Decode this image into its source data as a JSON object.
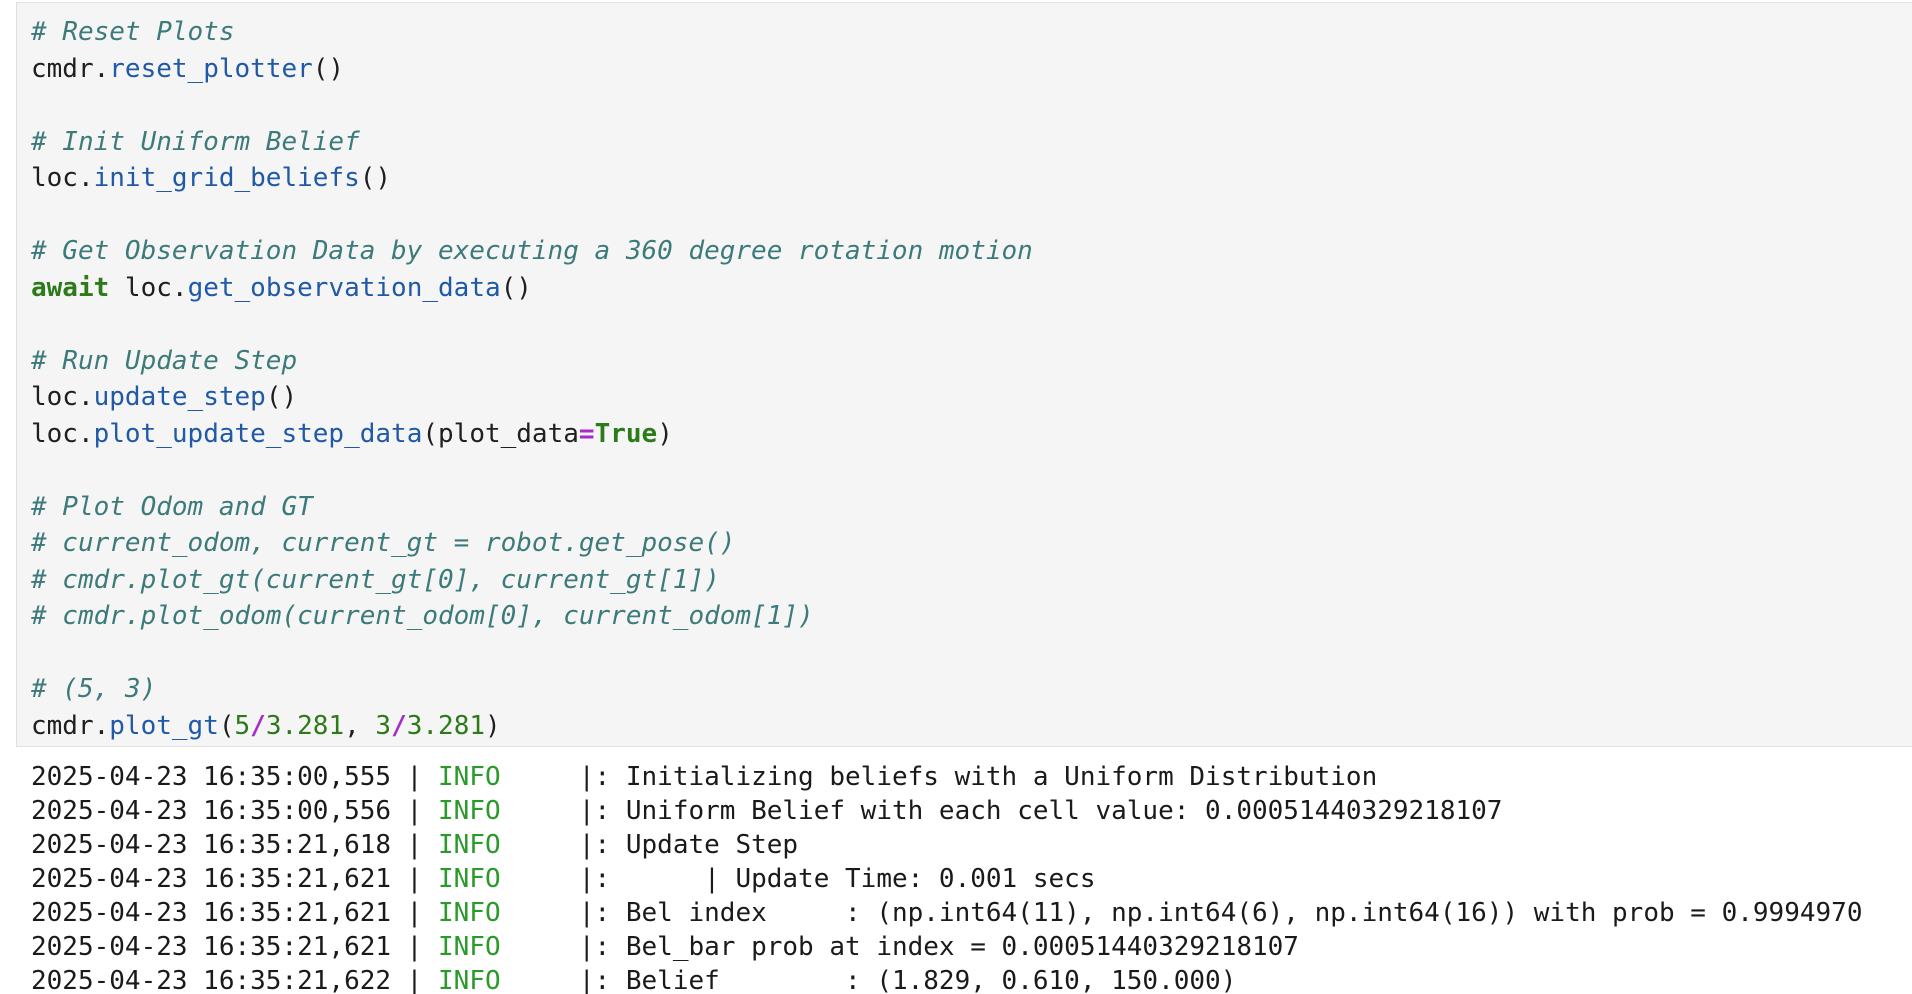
{
  "code_cell": {
    "lines": [
      [
        {
          "t": "# Reset Plots",
          "k": "c"
        }
      ],
      [
        {
          "t": "cmdr.",
          "k": ""
        },
        {
          "t": "reset_plotter",
          "k": "fn"
        },
        {
          "t": "()",
          "k": ""
        }
      ],
      [],
      [
        {
          "t": "# Init Uniform Belief",
          "k": "c"
        }
      ],
      [
        {
          "t": "loc.",
          "k": ""
        },
        {
          "t": "init_grid_beliefs",
          "k": "fn"
        },
        {
          "t": "()",
          "k": ""
        }
      ],
      [],
      [
        {
          "t": "# Get Observation Data by executing a 360 degree rotation motion",
          "k": "c"
        }
      ],
      [
        {
          "t": "await",
          "k": "kw"
        },
        {
          "t": " loc.",
          "k": ""
        },
        {
          "t": "get_observation_data",
          "k": "fn"
        },
        {
          "t": "()",
          "k": ""
        }
      ],
      [],
      [
        {
          "t": "# Run Update Step",
          "k": "c"
        }
      ],
      [
        {
          "t": "loc.",
          "k": ""
        },
        {
          "t": "update_step",
          "k": "fn"
        },
        {
          "t": "()",
          "k": ""
        }
      ],
      [
        {
          "t": "loc.",
          "k": ""
        },
        {
          "t": "plot_update_step_data",
          "k": "fn"
        },
        {
          "t": "(plot_data",
          "k": ""
        },
        {
          "t": "=",
          "k": "op"
        },
        {
          "t": "True",
          "k": "kw"
        },
        {
          "t": ")",
          "k": ""
        }
      ],
      [],
      [
        {
          "t": "# Plot Odom and GT",
          "k": "c"
        }
      ],
      [
        {
          "t": "# current_odom, current_gt = robot.get_pose()",
          "k": "c"
        }
      ],
      [
        {
          "t": "# cmdr.plot_gt(current_gt[0], current_gt[1])",
          "k": "c"
        }
      ],
      [
        {
          "t": "# cmdr.plot_odom(current_odom[0], current_odom[1])",
          "k": "c"
        }
      ],
      [],
      [
        {
          "t": "# (5, 3)",
          "k": "c"
        }
      ],
      [
        {
          "t": "cmdr.",
          "k": ""
        },
        {
          "t": "plot_gt",
          "k": "fn"
        },
        {
          "t": "(",
          "k": ""
        },
        {
          "t": "5",
          "k": "nm"
        },
        {
          "t": "/",
          "k": "op"
        },
        {
          "t": "3.281",
          "k": "nm"
        },
        {
          "t": ", ",
          "k": ""
        },
        {
          "t": "3",
          "k": "nm"
        },
        {
          "t": "/",
          "k": "op"
        },
        {
          "t": "3.281",
          "k": "nm"
        },
        {
          "t": ")",
          "k": ""
        }
      ]
    ]
  },
  "output": {
    "logs": [
      {
        "ts": "2025-04-23 16:35:00,555",
        "level": "INFO",
        "msg": "|: Initializing beliefs with a Uniform Distribution"
      },
      {
        "ts": "2025-04-23 16:35:00,556",
        "level": "INFO",
        "msg": "|: Uniform Belief with each cell value: 0.00051440329218107"
      },
      {
        "ts": "2025-04-23 16:35:21,618",
        "level": "INFO",
        "msg": "|: Update Step"
      },
      {
        "ts": "2025-04-23 16:35:21,621",
        "level": "INFO",
        "msg": "|:      | Update Time: 0.001 secs"
      },
      {
        "ts": "2025-04-23 16:35:21,621",
        "level": "INFO",
        "msg": "|: Bel index     : (np.int64(11), np.int64(6), np.int64(16)) with prob = 0.9994970"
      },
      {
        "ts": "2025-04-23 16:35:21,621",
        "level": "INFO",
        "msg": "|: Bel_bar prob at index = 0.00051440329218107"
      },
      {
        "ts": "2025-04-23 16:35:21,622",
        "level": "INFO",
        "msg": "|: Belief        : (1.829, 0.610, 150.000)"
      }
    ]
  },
  "colors": {
    "comment": "#3d7a7a",
    "function": "#2059a6",
    "keyword": "#2c7a1a",
    "operator": "#a22bc9",
    "log_level": "#2a9a2a",
    "cell_background": "#f5f5f5"
  }
}
